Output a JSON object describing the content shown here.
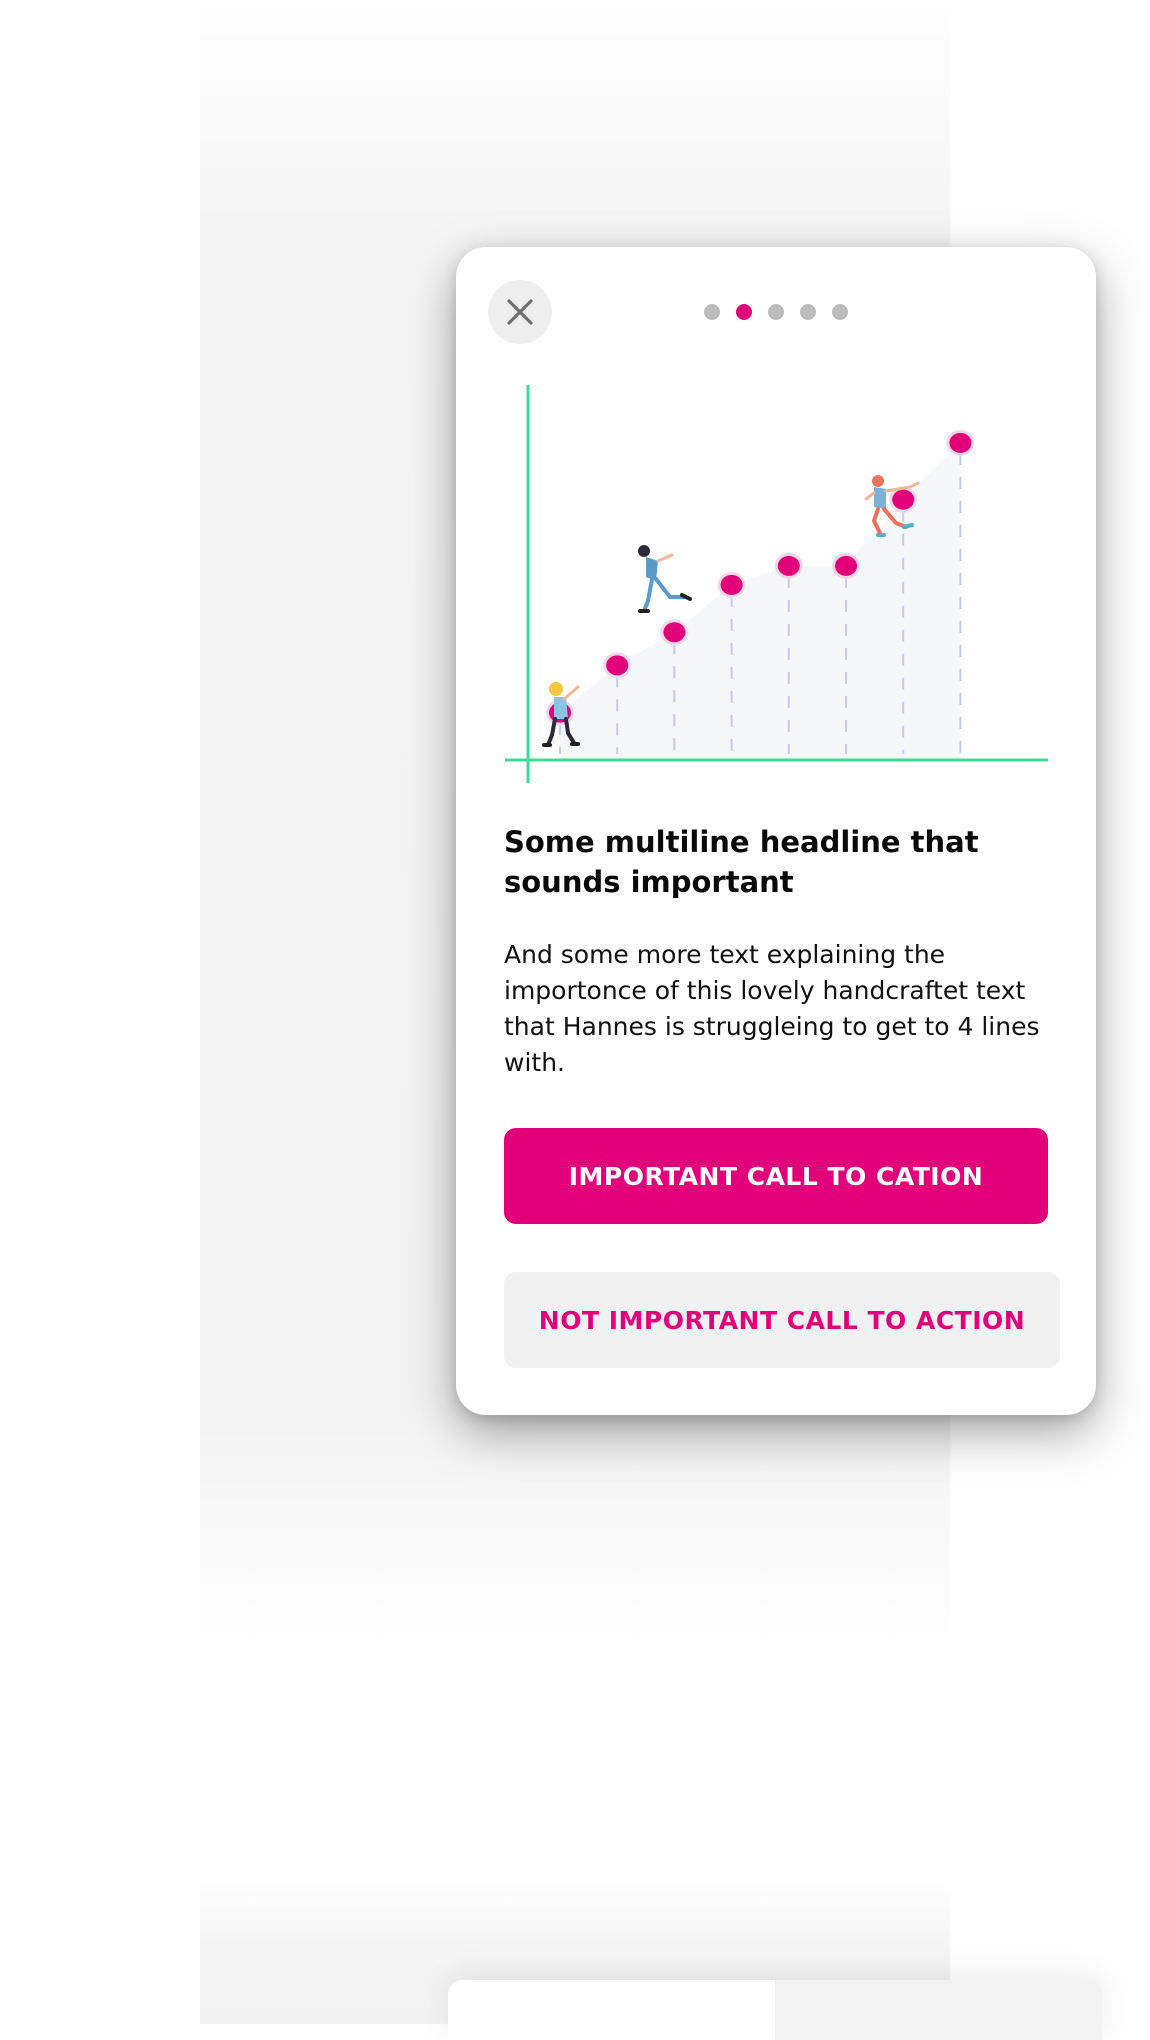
{
  "close": {
    "icon": "close-icon"
  },
  "pagination": {
    "count": 5,
    "active_index": 1
  },
  "chart_data": {
    "type": "line",
    "title": "",
    "xlabel": "",
    "ylabel": "",
    "x": [
      1,
      2,
      3,
      4,
      5,
      6,
      7,
      8
    ],
    "values": [
      1.0,
      2.0,
      2.7,
      3.7,
      4.1,
      4.1,
      5.5,
      6.7
    ],
    "ylim": [
      0,
      7.5
    ],
    "grid": false,
    "colors": {
      "axis": "#3ddc97",
      "point": "#e2007a",
      "guide": "#c8c8f4",
      "area": "#f6f7f9"
    }
  },
  "headline": "Some multiline headline that sounds important",
  "body": "And some more text explaining the importonce of this lovely handcraftet text that Hannes is struggleing to get to 4 lines with.",
  "primary_cta": "IMPORTANT CALL TO CATION",
  "secondary_cta": "NOT IMPORTANT CALL TO ACTION",
  "colors": {
    "accent": "#e2007a",
    "secondary_bg": "#f1f1f1"
  }
}
